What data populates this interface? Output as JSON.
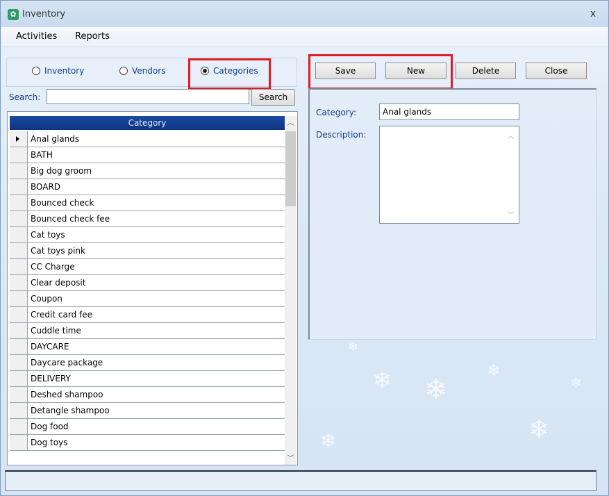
{
  "window": {
    "title": "Inventory",
    "close_glyph": "x",
    "app_icon": "app-icon"
  },
  "menu": {
    "items": [
      "Activities",
      "Reports"
    ]
  },
  "view_selector": {
    "options": [
      {
        "label": "Inventory",
        "checked": false
      },
      {
        "label": "Vendors",
        "checked": false
      },
      {
        "label": "Categories",
        "checked": true
      }
    ]
  },
  "search": {
    "label": "Search:",
    "value": "",
    "button_label": "Search"
  },
  "grid": {
    "column_header": "Category",
    "rows": [
      "Anal glands",
      "BATH",
      "Big dog groom",
      "BOARD",
      "Bounced check",
      "Bounced check fee",
      "Cat toys",
      "Cat toys pink",
      "CC Charge",
      "Clear deposit",
      "Coupon",
      "Credit card fee",
      "Cuddle time",
      "DAYCARE",
      "Daycare package",
      "DELIVERY",
      "Deshed shampoo",
      "Detangle shampoo",
      "Dog food",
      "Dog toys"
    ],
    "selected_row": 0
  },
  "toolbar": {
    "save_label": "Save",
    "new_label": "New",
    "delete_label": "Delete",
    "close_label": "Close"
  },
  "detail": {
    "category_label": "Category:",
    "category_value": "Anal glands",
    "description_label": "Description:",
    "description_value": ""
  },
  "colors": {
    "highlight": "#e01b22",
    "grid_header": "#1b4aa0",
    "label_text": "#123b88"
  }
}
